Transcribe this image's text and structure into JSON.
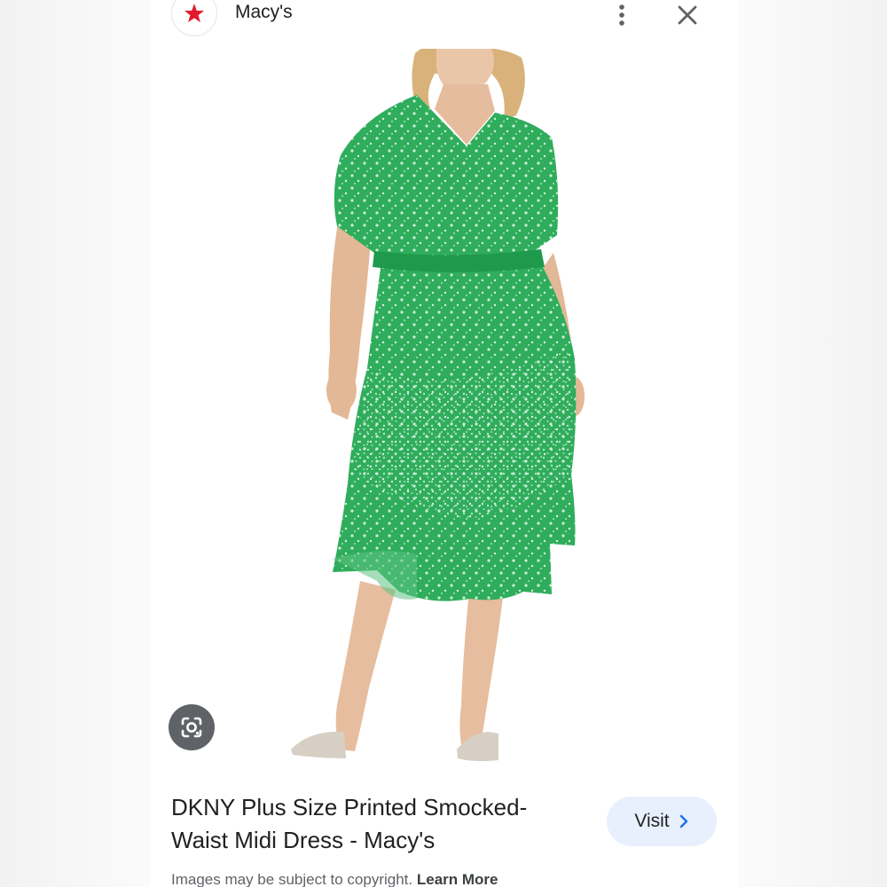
{
  "header": {
    "logo_icon": "macys-star-icon",
    "site_name": "Macy's",
    "more_icon": "more-vert-icon",
    "close_icon": "close-icon"
  },
  "image": {
    "subject": "model wearing green printed midi dress",
    "dress_color": "#2fad5c",
    "lens_icon": "google-lens-icon"
  },
  "result": {
    "title": "DKNY Plus Size Printed Smocked-Waist Midi Dress - Macy's",
    "visit_label": "Visit",
    "visit_icon": "chevron-right-icon"
  },
  "footer": {
    "copyright_text": "Images may be subject to copyright.",
    "learn_more": "Learn More"
  },
  "colors": {
    "accent_star": "#e21a2c",
    "visit_bg": "#e8f0fe",
    "link_blue": "#1a73e8"
  }
}
